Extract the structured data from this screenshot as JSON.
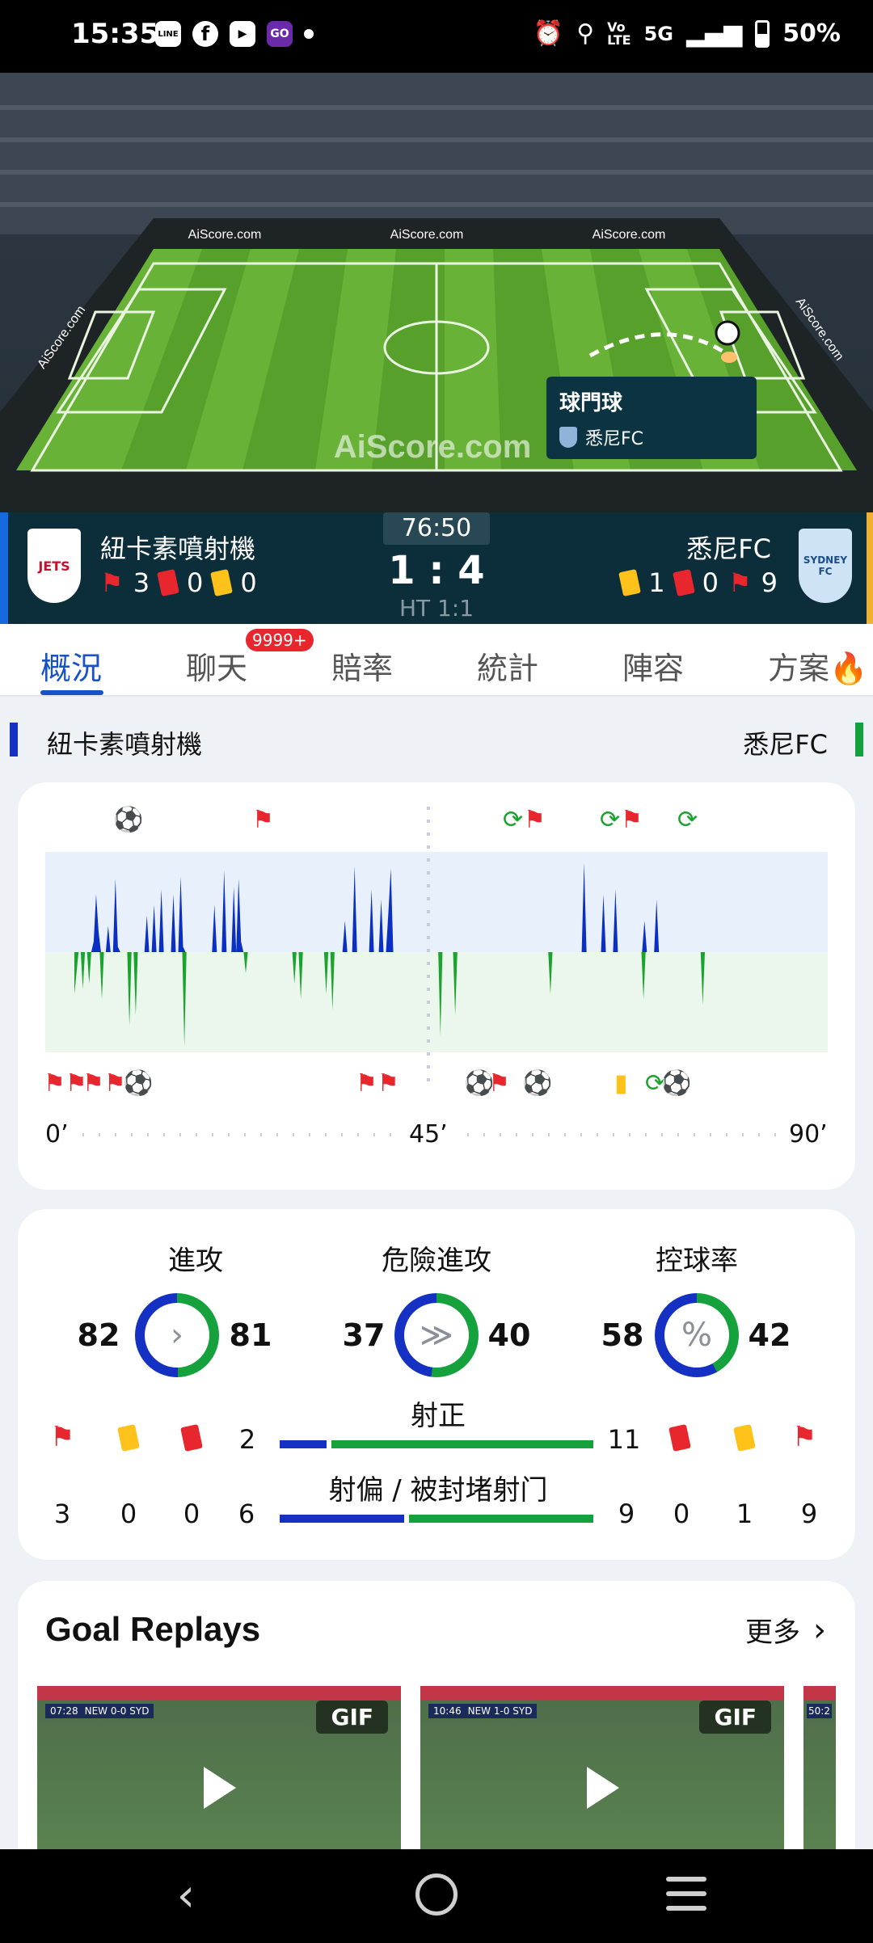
{
  "status_bar": {
    "time": "15:35",
    "apps": [
      "LINE",
      "f",
      "▶",
      "GO"
    ],
    "network": "5G",
    "battery": "50%"
  },
  "pitch": {
    "ads": [
      "AiScore.com",
      "AiScore.com",
      "AiScore.com",
      "AiScore.com",
      "AiScore.com"
    ],
    "watermark": "AiScore.com",
    "event_title": "球門球",
    "event_team": "悉尼FC"
  },
  "scoreboard": {
    "home_name": "紐卡素噴射機",
    "away_name": "悉尼FC",
    "clock": "76:50",
    "score": "1 : 4",
    "halftime": "HT 1:1",
    "home_crest": "JETS",
    "away_crest": "SYDNEY FC",
    "home_corners": "3",
    "home_red": "0",
    "home_yellow": "0",
    "away_yellow": "1",
    "away_red": "0",
    "away_corners": "9"
  },
  "tabs": [
    {
      "label": "概況",
      "active": true
    },
    {
      "label": "聊天",
      "badge": "9999+"
    },
    {
      "label": "賠率"
    },
    {
      "label": "統計"
    },
    {
      "label": "陣容"
    },
    {
      "label": "方案"
    }
  ],
  "teams_header": {
    "home": "紐卡素噴射機",
    "away": "悉尼FC"
  },
  "timeline": {
    "ticks": [
      "0’",
      "45’",
      "90’"
    ],
    "colors": {
      "home": "#0a2fc2",
      "away": "#1aa32f"
    },
    "home_pressure": [
      0,
      0,
      0,
      0,
      0,
      0,
      0,
      0,
      10,
      55,
      20,
      0,
      0,
      0,
      25,
      0,
      0,
      70,
      5,
      0,
      0,
      0,
      0,
      0,
      0,
      0,
      0,
      0,
      0,
      0,
      35,
      0,
      0,
      45,
      0,
      0,
      60,
      0,
      0,
      0,
      0,
      55,
      0,
      0,
      72,
      5,
      0,
      0,
      0,
      0,
      0,
      0,
      0,
      0,
      0,
      0,
      0,
      0,
      45,
      0,
      0,
      0,
      78,
      0,
      0,
      0,
      62,
      0,
      70,
      10,
      0,
      0,
      0,
      0,
      0,
      0,
      0,
      0,
      0,
      0,
      0,
      0,
      0,
      0,
      0,
      0,
      0,
      0,
      0,
      0,
      0,
      0,
      0,
      0,
      0,
      0,
      0,
      0,
      0,
      0,
      0,
      0,
      0,
      0,
      0,
      0,
      0,
      0,
      0,
      0,
      0,
      0,
      30,
      0,
      0,
      0,
      82,
      0,
      0,
      0,
      0,
      0,
      0,
      60,
      0,
      0,
      0,
      50,
      0,
      0,
      38,
      80,
      0,
      0,
      0,
      0,
      0,
      0,
      0,
      0,
      0,
      0,
      0,
      0,
      0,
      0,
      0,
      0,
      0,
      0,
      0,
      0,
      0,
      0,
      0,
      0,
      0,
      0,
      0,
      0,
      0,
      0,
      0,
      0,
      0,
      0,
      0,
      0,
      0,
      0,
      0,
      0,
      0,
      0,
      0,
      0,
      0,
      0,
      0,
      0,
      0,
      0,
      0,
      0,
      0,
      0,
      0,
      0,
      0,
      0,
      0,
      0,
      0,
      0,
      0,
      0,
      0,
      0,
      0,
      0,
      0,
      0,
      0,
      0,
      0,
      0,
      0,
      0,
      0,
      0,
      0,
      85,
      0,
      0,
      0,
      0,
      0,
      0,
      0,
      55,
      0,
      0,
      0,
      0,
      60,
      0,
      0,
      0,
      0,
      0,
      0,
      0,
      0,
      0,
      0,
      0,
      30,
      0,
      0,
      0,
      0,
      50,
      0,
      0,
      0,
      0,
      0,
      0,
      0,
      0,
      0,
      0,
      0,
      0,
      0,
      0,
      0,
      0,
      0,
      0,
      0
    ],
    "away_pressure": [
      40,
      20,
      0,
      0,
      35,
      0,
      0,
      30,
      0,
      0,
      0,
      0,
      0,
      45,
      0,
      0,
      0,
      0,
      0,
      0,
      0,
      0,
      0,
      0,
      0,
      0,
      70,
      0,
      0,
      60,
      0,
      0,
      0,
      0,
      0,
      0,
      0,
      0,
      0,
      0,
      0,
      0,
      0,
      0,
      0,
      0,
      0,
      0,
      0,
      0,
      0,
      0,
      90,
      0,
      0,
      0,
      0,
      0,
      0,
      0,
      0,
      0,
      0,
      0,
      0,
      0,
      0,
      0,
      0,
      0,
      0,
      0,
      0,
      0,
      0,
      0,
      0,
      0,
      0,
      0,
      0,
      20,
      0,
      0,
      0,
      0,
      0,
      0,
      0,
      0,
      0,
      0,
      0,
      0,
      0,
      0,
      0,
      0,
      0,
      0,
      0,
      0,
      0,
      0,
      30,
      0,
      0,
      45,
      0,
      0,
      0,
      0,
      0,
      0,
      0,
      0,
      0,
      0,
      0,
      40,
      0,
      0,
      55,
      0,
      0,
      0,
      0,
      0,
      0,
      0,
      0,
      0,
      0,
      0,
      0,
      0,
      0,
      0,
      0,
      0,
      0,
      0,
      0,
      0,
      0,
      0,
      0,
      0,
      0,
      0,
      0,
      0,
      0,
      0,
      0,
      0,
      0,
      0,
      0,
      0,
      0,
      0,
      0,
      0,
      0,
      0,
      0,
      0,
      0,
      0,
      0,
      0,
      0,
      80,
      0,
      0,
      0,
      0,
      0,
      0,
      60,
      0,
      0,
      0,
      0,
      0,
      0,
      0,
      0,
      0,
      0,
      0,
      0,
      0,
      0,
      0,
      0,
      0,
      0,
      0,
      0,
      0,
      0,
      0,
      0,
      0,
      0,
      0,
      0,
      0,
      0,
      0,
      0,
      0,
      0,
      0,
      0,
      0,
      0,
      0,
      0,
      0,
      0,
      0,
      0,
      40,
      0,
      0,
      0,
      0,
      0,
      0,
      0,
      0,
      0,
      0,
      0,
      0,
      0,
      0,
      0,
      0,
      0,
      0,
      0,
      0,
      0,
      0,
      0,
      0,
      0,
      0,
      0,
      0,
      0,
      0,
      0,
      0,
      0,
      0,
      0,
      0,
      0,
      0,
      0,
      0,
      0,
      0,
      0,
      45,
      0,
      0,
      0,
      0,
      0,
      0,
      0,
      0,
      0,
      0,
      0,
      0,
      0,
      0,
      0,
      0,
      0,
      0,
      0,
      0,
      0,
      0,
      0,
      0,
      0,
      0,
      0,
      50
    ]
  },
  "stats": {
    "circles": [
      {
        "label": "進攻",
        "home": "82",
        "away": "81",
        "home_share": 0.503,
        "icon": ">"
      },
      {
        "label": "危險進攻",
        "home": "37",
        "away": "40",
        "home_share": 0.48,
        "icon": "≫"
      },
      {
        "label": "控球率",
        "home": "58",
        "away": "42",
        "home_share": 0.58,
        "icon": "%"
      }
    ],
    "shots_on": {
      "label": "射正",
      "home": "2",
      "away": "11"
    },
    "shots_off": {
      "label": "射偏 / 被封堵射门",
      "home": "6",
      "away": "9"
    },
    "home_corners": "3",
    "home_yellow": "0",
    "home_red": "0",
    "away_red": "0",
    "away_yellow": "1",
    "away_corners": "9"
  },
  "replays": {
    "title": "Goal Replays",
    "more": "更多",
    "items": [
      {
        "badge": "GIF",
        "score": "NEW 0-0 SYD",
        "time": "07:28"
      },
      {
        "badge": "GIF",
        "score": "NEW 1-0 SYD",
        "time": "10:46"
      },
      {
        "time": "50:2"
      }
    ]
  }
}
